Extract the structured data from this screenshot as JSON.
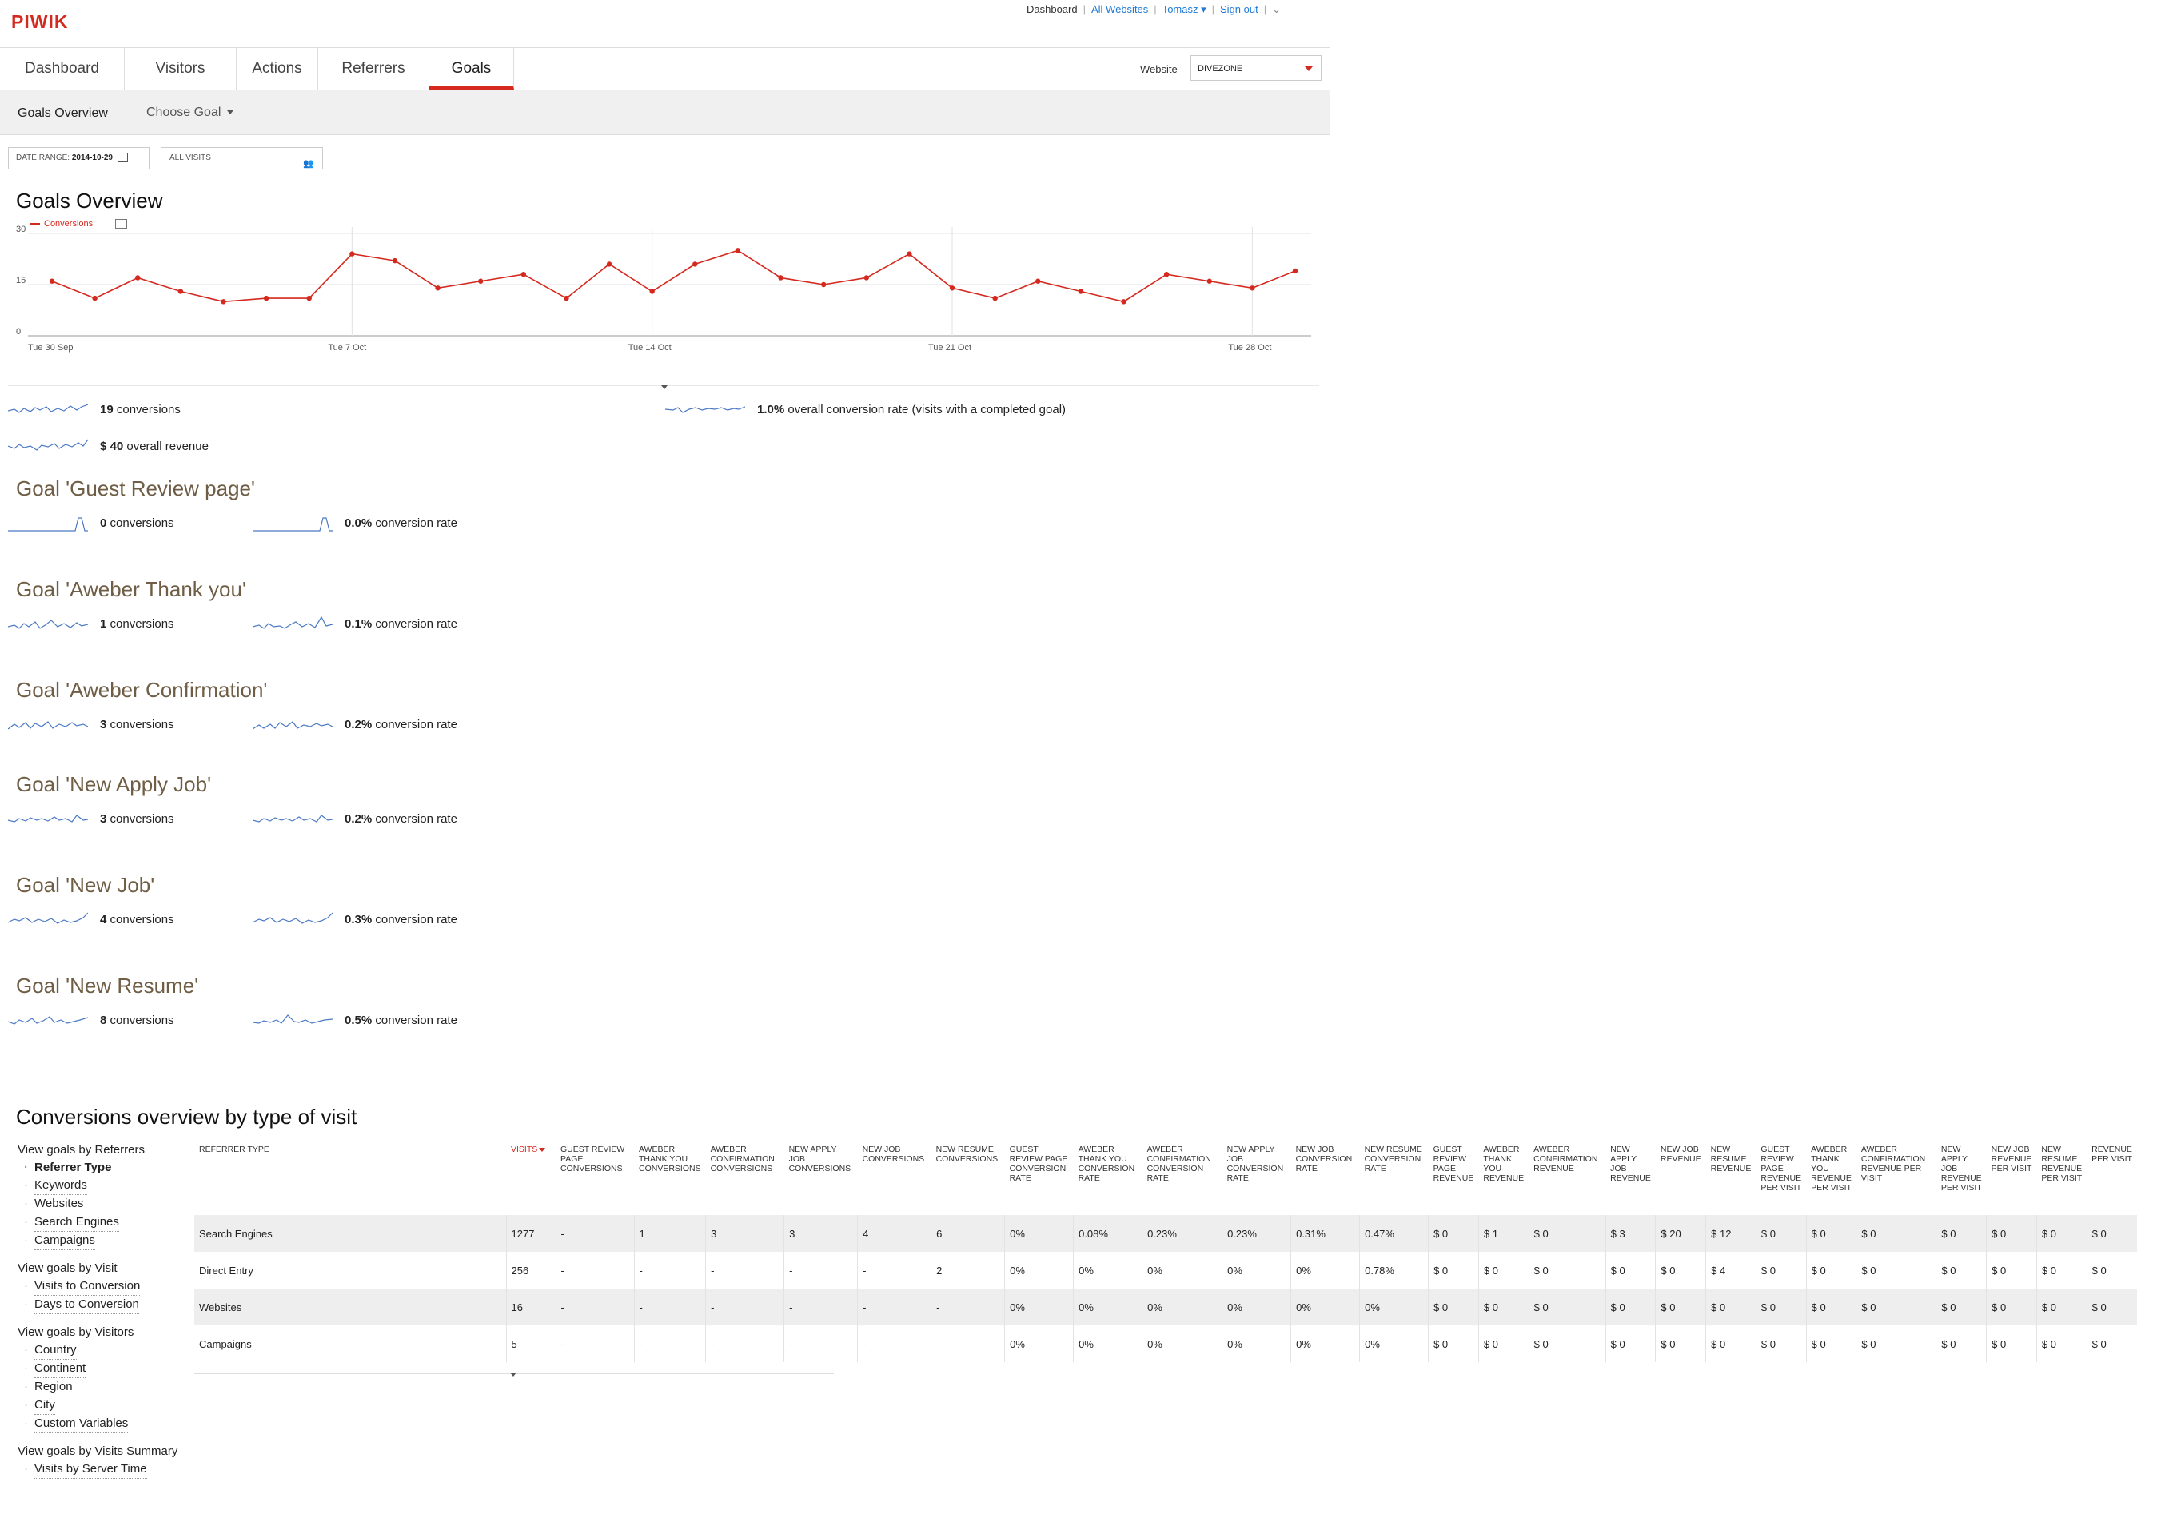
{
  "header": {
    "logo": "PIWIK",
    "links": {
      "dashboard": "Dashboard",
      "all_websites": "All Websites",
      "user": "Tomasz",
      "sign_out": "Sign out"
    },
    "tabs": [
      "Dashboard",
      "Visitors",
      "Actions",
      "Referrers",
      "Goals"
    ],
    "active_tab": "Goals",
    "website_label": "Website",
    "website_value": "DIVEZONE"
  },
  "subnav": {
    "overview": "Goals Overview",
    "choose_goal": "Choose Goal"
  },
  "filters": {
    "date_range_label": "DATE RANGE:",
    "date_range_value": "2014-10-29",
    "segment": "ALL VISITS"
  },
  "overview": {
    "title": "Goals Overview",
    "legend": "Conversions",
    "conversions_value": "19",
    "conversions_label": "conversions",
    "rate_value": "1.0%",
    "rate_label": "overall conversion rate (visits with a completed goal)",
    "revenue_value": "$ 40",
    "revenue_label": "overall revenue"
  },
  "chart_data": {
    "type": "line",
    "series": [
      {
        "name": "Conversions",
        "values": [
          16,
          11,
          17,
          13,
          10,
          11,
          11,
          24,
          22,
          14,
          16,
          18,
          11,
          21,
          13,
          21,
          25,
          17,
          15,
          17,
          24,
          14,
          11,
          16,
          13,
          10,
          18,
          16,
          14,
          19
        ]
      }
    ],
    "x_ticks": [
      "Tue 30 Sep",
      "Tue 7 Oct",
      "Tue 14 Oct",
      "Tue 21 Oct",
      "Tue 28 Oct"
    ],
    "y_ticks": [
      "0",
      "15",
      "30"
    ],
    "ylim": [
      0,
      30
    ],
    "grid": true,
    "color": "#d4291f"
  },
  "goals": [
    {
      "title": "Goal 'Guest Review page'",
      "conversions": "0",
      "conversions_label": "conversions",
      "rate": "0.0%",
      "rate_label": "conversion rate"
    },
    {
      "title": "Goal 'Aweber Thank you'",
      "conversions": "1",
      "conversions_label": "conversions",
      "rate": "0.1%",
      "rate_label": "conversion rate"
    },
    {
      "title": "Goal 'Aweber Confirmation'",
      "conversions": "3",
      "conversions_label": "conversions",
      "rate": "0.2%",
      "rate_label": "conversion rate"
    },
    {
      "title": "Goal 'New Apply Job'",
      "conversions": "3",
      "conversions_label": "conversions",
      "rate": "0.2%",
      "rate_label": "conversion rate"
    },
    {
      "title": "Goal 'New Job'",
      "conversions": "4",
      "conversions_label": "conversions",
      "rate": "0.3%",
      "rate_label": "conversion rate"
    },
    {
      "title": "Goal 'New Resume'",
      "conversions": "8",
      "conversions_label": "conversions",
      "rate": "0.5%",
      "rate_label": "conversion rate"
    }
  ],
  "conversions_by_type": {
    "title": "Conversions overview by type of visit",
    "nav": [
      {
        "heading": "View goals by Referrers",
        "items": [
          "Referrer Type",
          "Keywords",
          "Websites",
          "Search Engines",
          "Campaigns"
        ]
      },
      {
        "heading": "View goals by Visit",
        "items": [
          "Visits to Conversion",
          "Days to Conversion"
        ]
      },
      {
        "heading": "View goals by Visitors",
        "items": [
          "Country",
          "Continent",
          "Region",
          "City",
          "Custom Variables"
        ]
      },
      {
        "heading": "View goals by Visits Summary",
        "items": [
          "Visits by Server Time"
        ]
      }
    ],
    "active_item": "Referrer Type",
    "columns": [
      "REFERRER TYPE",
      "VISITS",
      "GUEST REVIEW PAGE CONVERSIONS",
      "AWEBER THANK YOU CONVERSIONS",
      "AWEBER CONFIRMATION CONVERSIONS",
      "NEW APPLY JOB CONVERSIONS",
      "NEW JOB CONVERSIONS",
      "NEW RESUME CONVERSIONS",
      "GUEST REVIEW PAGE CONVERSION RATE",
      "AWEBER THANK YOU CONVERSION RATE",
      "AWEBER CONFIRMATION CONVERSION RATE",
      "NEW APPLY JOB CONVERSION RATE",
      "NEW JOB CONVERSION RATE",
      "NEW RESUME CONVERSION RATE",
      "GUEST REVIEW PAGE REVENUE",
      "AWEBER THANK YOU REVENUE",
      "AWEBER CONFIRMATION REVENUE",
      "NEW APPLY JOB REVENUE",
      "NEW JOB REVENUE",
      "NEW RESUME REVENUE",
      "GUEST REVIEW PAGE REVENUE PER VISIT",
      "AWEBER THANK YOU REVENUE PER VISIT",
      "AWEBER CONFIRMATION REVENUE PER VISIT",
      "NEW APPLY JOB REVENUE PER VISIT",
      "NEW JOB REVENUE PER VISIT",
      "NEW RESUME REVENUE PER VISIT",
      "REVENUE PER VISIT"
    ],
    "rows": [
      [
        "Search Engines",
        "1277",
        "-",
        "1",
        "3",
        "3",
        "4",
        "6",
        "0%",
        "0.08%",
        "0.23%",
        "0.23%",
        "0.31%",
        "0.47%",
        "$ 0",
        "$ 1",
        "$ 0",
        "$ 3",
        "$ 20",
        "$ 12",
        "$ 0",
        "$ 0",
        "$ 0",
        "$ 0",
        "$ 0",
        "$ 0",
        "$ 0"
      ],
      [
        "Direct Entry",
        "256",
        "-",
        "-",
        "-",
        "-",
        "-",
        "2",
        "0%",
        "0%",
        "0%",
        "0%",
        "0%",
        "0.78%",
        "$ 0",
        "$ 0",
        "$ 0",
        "$ 0",
        "$ 0",
        "$ 4",
        "$ 0",
        "$ 0",
        "$ 0",
        "$ 0",
        "$ 0",
        "$ 0",
        "$ 0"
      ],
      [
        "Websites",
        "16",
        "-",
        "-",
        "-",
        "-",
        "-",
        "-",
        "0%",
        "0%",
        "0%",
        "0%",
        "0%",
        "0%",
        "$ 0",
        "$ 0",
        "$ 0",
        "$ 0",
        "$ 0",
        "$ 0",
        "$ 0",
        "$ 0",
        "$ 0",
        "$ 0",
        "$ 0",
        "$ 0",
        "$ 0"
      ],
      [
        "Campaigns",
        "5",
        "-",
        "-",
        "-",
        "-",
        "-",
        "-",
        "0%",
        "0%",
        "0%",
        "0%",
        "0%",
        "0%",
        "$ 0",
        "$ 0",
        "$ 0",
        "$ 0",
        "$ 0",
        "$ 0",
        "$ 0",
        "$ 0",
        "$ 0",
        "$ 0",
        "$ 0",
        "$ 0",
        "$ 0"
      ]
    ]
  }
}
